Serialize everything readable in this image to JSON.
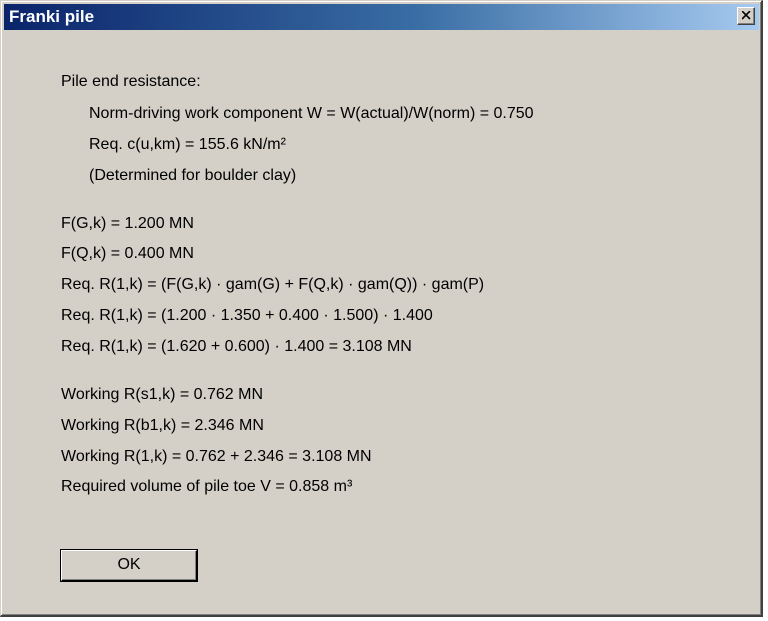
{
  "window": {
    "title": "Franki pile",
    "close_icon": "close-icon"
  },
  "colors": {
    "title_gradient_start": "#0a246a",
    "title_gradient_end": "#a6caf0",
    "face": "#d4d0c8"
  },
  "content": {
    "heading": "Pile end resistance:",
    "norm_line": "Norm-driving work component W  = W(actual)/W(norm) = 0.750",
    "req_c_line": "Req. c(u,km) = 155.6 kN/m²",
    "determined_line": "(Determined for boulder clay)",
    "fg_line": "F(G,k) = 1.200 MN",
    "fq_line": "F(Q,k) = 0.400 MN",
    "req_r1_formula": "Req. R(1,k) = (F(G,k) · gam(G) + F(Q,k) · gam(Q)) · gam(P)",
    "req_r1_substituted": "Req. R(1,k) = (1.200 · 1.350 + 0.400 · 1.500) · 1.400",
    "req_r1_result": "Req. R(1,k) = (1.620 + 0.600) · 1.400 = 3.108 MN",
    "working_rs1": "Working R(s1,k) = 0.762 MN",
    "working_rb1": "Working R(b1,k) = 2.346 MN",
    "working_r1": "Working R(1,k) = 0.762 + 2.346 = 3.108 MN",
    "required_volume": "Required volume of pile toe V = 0.858 m³"
  },
  "buttons": {
    "ok_label": "OK"
  }
}
